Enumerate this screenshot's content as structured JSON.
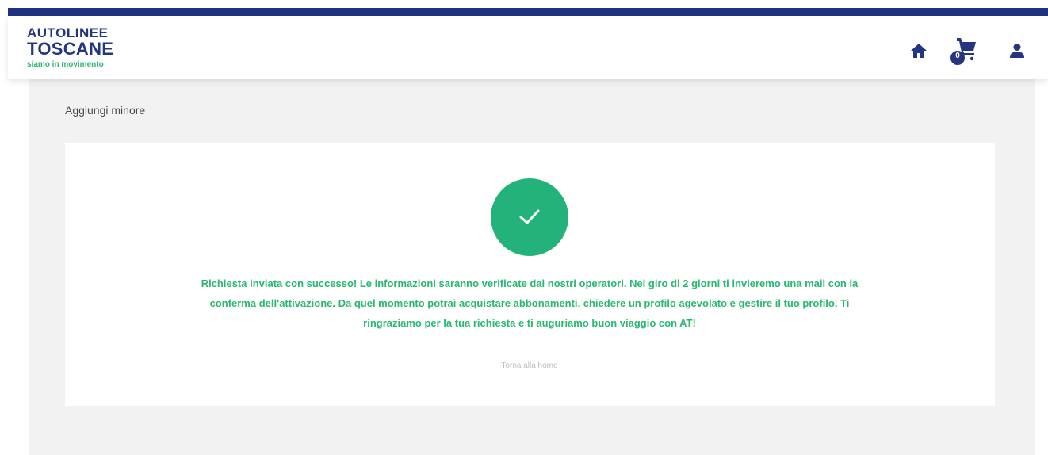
{
  "header": {
    "logo": {
      "line1": "AUTOLINEE",
      "line2": "TOSCANE",
      "tagline": "siamo in movimento"
    },
    "icons": [
      "home-icon",
      "cart-icon",
      "user-icon"
    ],
    "cart_count": "0"
  },
  "page": {
    "subtitle": "Aggiungi minore"
  },
  "confirmation": {
    "message": "Richiesta inviata con successo! Le informazioni saranno verificate dai nostri operatori. Nel giro di 2 giorni ti invieremo una mail con la conferma dell'attivazione. Da quel momento potrai acquistare abbonamenti, chiedere un profilo agevolato e gestire il tuo profilo. Ti ringraziamo per la tua richiesta e ti auguriamo buon viaggio con AT!",
    "home_link": "Torna alla home"
  },
  "colors": {
    "brand_blue": "#1f3280",
    "accent_green": "#23b37a",
    "background": "#f2f2f2"
  }
}
